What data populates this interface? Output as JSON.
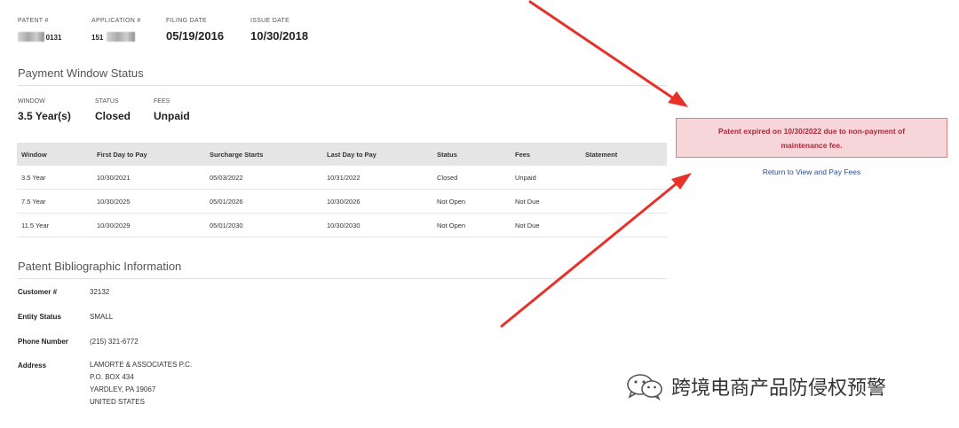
{
  "header": {
    "patent": {
      "label": "PATENT #",
      "value": "0131"
    },
    "application": {
      "label": "APPLICATION #",
      "value": "151"
    },
    "filing_date": {
      "label": "FILING DATE",
      "value": "05/19/2016"
    },
    "issue_date": {
      "label": "ISSUE DATE",
      "value": "10/30/2018"
    }
  },
  "payment_window": {
    "title": "Payment Window Status",
    "window": {
      "label": "WINDOW",
      "value": "3.5 Year(s)"
    },
    "status": {
      "label": "STATUS",
      "value": "Closed"
    },
    "fees": {
      "label": "FEES",
      "value": "Unpaid"
    }
  },
  "table": {
    "columns": [
      "Window",
      "First Day to Pay",
      "Surcharge Starts",
      "Last Day to Pay",
      "Status",
      "Fees",
      "Statement"
    ],
    "rows": [
      [
        "3.5 Year",
        "10/30/2021",
        "05/03/2022",
        "10/31/2022",
        "Closed",
        "Unpaid",
        ""
      ],
      [
        "7.5 Year",
        "10/30/2025",
        "05/01/2026",
        "10/30/2026",
        "Not Open",
        "Not Due",
        ""
      ],
      [
        "11.5 Year",
        "10/30/2029",
        "05/01/2030",
        "10/30/2030",
        "Not Open",
        "Not Due",
        ""
      ]
    ]
  },
  "bibliographic": {
    "title": "Patent Bibliographic Information",
    "customer": {
      "label": "Customer #",
      "value": "32132"
    },
    "entity_status": {
      "label": "Entity Status",
      "value": "SMALL"
    },
    "phone": {
      "label": "Phone Number",
      "value": "(215) 321-6772"
    },
    "address": {
      "label": "Address",
      "lines": [
        "LAMORTE & ASSOCIATES P.C.",
        "P.O. BOX 434",
        "YARDLEY, PA 19067",
        "UNITED STATES"
      ]
    }
  },
  "alert": {
    "message": "Patent expired on 10/30/2022 due to non-payment of maintenance fee.",
    "link": "Return to View and Pay Fees"
  },
  "watermark": {
    "text": "跨境电商产品防侵权预警"
  },
  "colors": {
    "arrow": "#e8312a",
    "alert_bg": "#f6d6d9",
    "alert_border": "#e07c86",
    "alert_text": "#b0263a",
    "link": "#2a4e8f",
    "table_header_bg": "#e5e5e5"
  },
  "icons": {
    "watermark_icon": "wechat-icon"
  }
}
